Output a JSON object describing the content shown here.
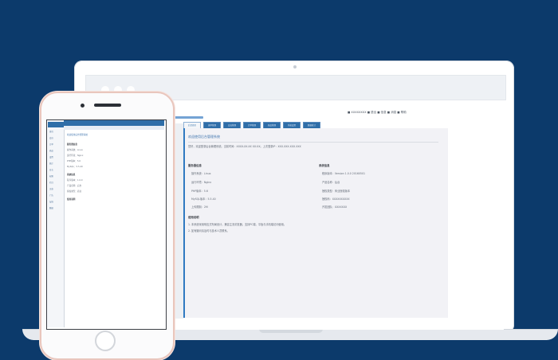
{
  "colors": {
    "background": "#0c3a6b",
    "accent": "#2f6ea8",
    "panel": "#f2f2f6",
    "highlight": "#2f79c1"
  },
  "laptop": {
    "topright_links": "■ XXXXXXXX ■ 退出  ■ 信息  ■ 消息  ■ 帮助",
    "tabs": [
      {
        "label": "后台首页",
        "active": true
      },
      {
        "label": "菜单管理",
        "active": false
      },
      {
        "label": "会员管理",
        "active": false
      },
      {
        "label": "订单管理",
        "active": false
      },
      {
        "label": "商品管理",
        "active": false
      },
      {
        "label": "系统设置",
        "active": false
      },
      {
        "label": "数据统计",
        "active": false
      }
    ],
    "panel": {
      "title": "欢迎使用后台管理系统",
      "intro": "您好，欢迎登录后台管理系统。当前时间：XXXX-XX-XX XX:XX。上次登录IP：XXX.XXX.XXX.XXX",
      "left_group": {
        "heading": "服务器信息",
        "rows": [
          "操作系统：Linux",
          "运行环境：Nginx",
          "PHP版本：5.6",
          "MySQL版本：5.5.40",
          "上传限制：2M"
        ]
      },
      "right_group": {
        "heading": "系统信息",
        "rows": [
          "程序版本：Version 1.0.0 20160501",
          "产品名称：后台",
          "授权类型：商业授权版本",
          "授权码：XXXXXXXXXX",
          "开发团队：XXXXXXX"
        ]
      },
      "notes_heading": "使用说明",
      "notes": [
        "1. 本系统采用响应式布局设计，兼容主流浏览器，支持PC端、平板与手机端访问使用。",
        "2. 如有疑问请及时与技术人员联系。"
      ]
    }
  },
  "phone": {
    "sidebar_items": [
      "首页",
      "会员",
      "订单",
      "商品",
      "设置",
      "统计",
      "日志",
      "权限",
      "栏目",
      "文章",
      "广告",
      "友链",
      "数据"
    ],
    "content_lines": [
      "欢迎使用后台管理系统",
      "服务器信息",
      "操作系统：Linux",
      "运行环境：Nginx",
      "PHP版本：5.6",
      "MySQL：5.5.40",
      "系统信息",
      "程序版本：1.0.0",
      "产品名称：后台",
      "授权类型：商业",
      "使用说明"
    ]
  }
}
